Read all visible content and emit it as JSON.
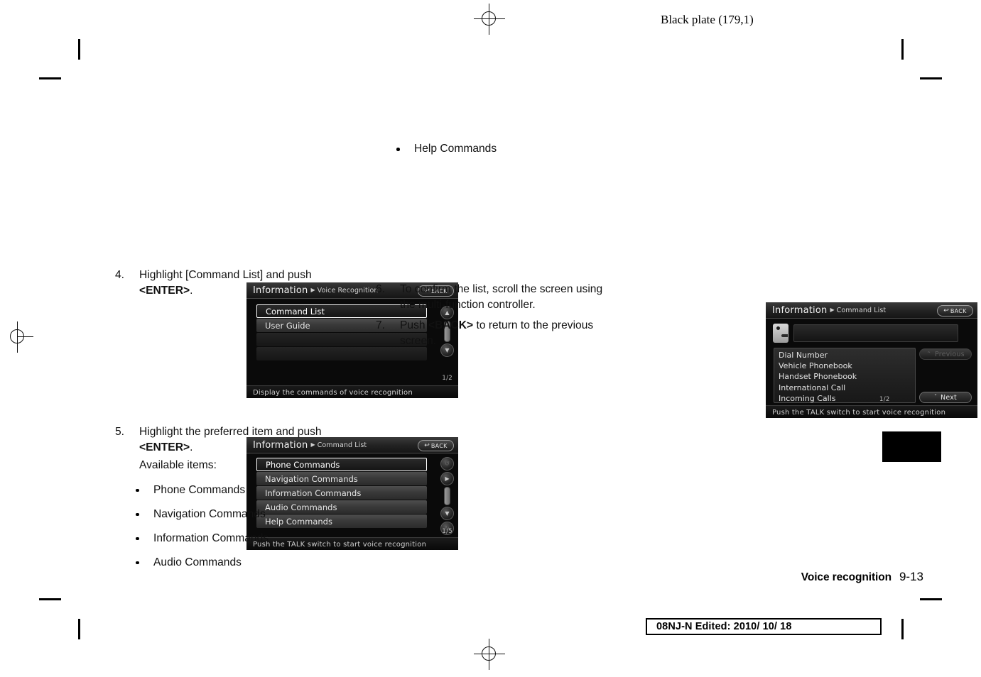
{
  "header": {
    "black_plate": "Black plate (179,1)"
  },
  "footer": {
    "chapter": "Voice recognition",
    "page_number": "9-13",
    "revision": "08NJ-N Edited:  2010/ 10/ 18"
  },
  "left_column": {
    "step4": {
      "number": "4.",
      "text_before": "Highlight [Command List] and push",
      "bold": "<ENTER>",
      "text_after": "."
    },
    "step5": {
      "number": "5.",
      "text_before": "Highlight the preferred item and push",
      "bold": "<ENTER>",
      "text_after": "."
    },
    "available_label": "Available items:",
    "available_items": [
      "Phone Commands",
      "Navigation Commands",
      "Information Commands",
      "Audio Commands"
    ]
  },
  "right_column": {
    "continued_item": "Help Commands",
    "step6": {
      "number": "6.",
      "line1": "To confirm the list, scroll the screen using",
      "line2": "the multi-function controller."
    },
    "step7": {
      "number": "7.",
      "text_before": "Push",
      "bold": "<BACK>",
      "text_after": "to return to the previous",
      "line2": "screen."
    }
  },
  "screenshot1": {
    "title": "Information",
    "breadcrumb": "Voice Recognition",
    "back_label": "BACK",
    "back_glyph": "↩",
    "menu_items": [
      {
        "label": "Command List",
        "selected": true
      },
      {
        "label": "User Guide",
        "selected": false
      }
    ],
    "page_indicator": "1/2",
    "status_text": "Display the commands of voice recognition",
    "scroll_up_glyph": "▲",
    "scroll_down_glyph": "▼"
  },
  "screenshot2": {
    "title": "Information",
    "breadcrumb": "Command List",
    "back_label": "BACK",
    "back_glyph": "↩",
    "menu_items": [
      {
        "label": "Phone Commands",
        "selected": true
      },
      {
        "label": "Navigation Commands",
        "selected": false
      },
      {
        "label": "Information Commands",
        "selected": false
      },
      {
        "label": "Audio Commands",
        "selected": false
      },
      {
        "label": "Help Commands",
        "selected": false
      }
    ],
    "page_indicator": "1/5",
    "status_text": "Push the TALK switch to start voice recognition",
    "knob_glyphs": [
      "↺",
      "▶",
      "▼",
      "↻"
    ]
  },
  "screenshot3": {
    "title": "Information",
    "breadcrumb": "Command List",
    "back_label": "BACK",
    "back_glyph": "↩",
    "voice_input_value": "",
    "command_lines": [
      "Dial Number",
      "Vehicle Phonebook",
      "Handset Phonebook",
      "International Call",
      "Incoming Calls"
    ],
    "previous_label": "Previous",
    "previous_glyph": "⌃",
    "next_label": "Next",
    "next_glyph": "ˇ",
    "page_indicator": "1/2",
    "status_text": "Push the TALK switch to start voice recognition"
  }
}
